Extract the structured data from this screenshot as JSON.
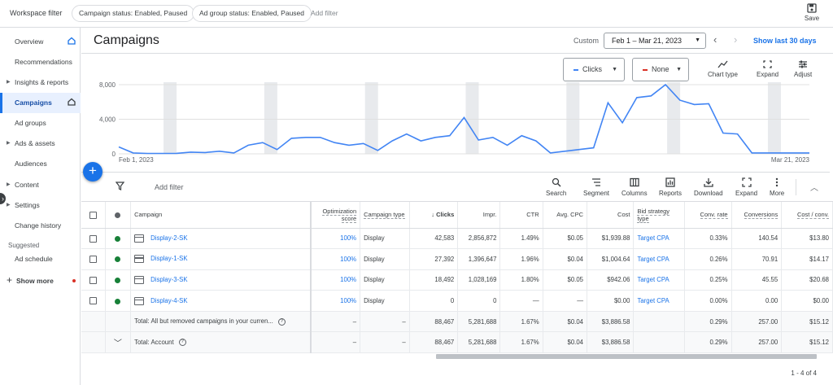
{
  "topbar": {
    "workspace_filter": "Workspace filter",
    "chips": [
      "Campaign status: Enabled, Paused",
      "Ad group status: Enabled, Paused"
    ],
    "add_filter": "Add filter",
    "save": "Save"
  },
  "sidebar": {
    "items": [
      {
        "label": "Overview",
        "arrow": false,
        "home": true
      },
      {
        "label": "Recommendations",
        "arrow": false
      },
      {
        "label": "Insights & reports",
        "arrow": true
      },
      {
        "label": "Campaigns",
        "arrow": false,
        "home": true,
        "active": true
      },
      {
        "label": "Ad groups",
        "arrow": false
      },
      {
        "label": "Ads & assets",
        "arrow": true
      },
      {
        "label": "Audiences",
        "arrow": false
      },
      {
        "label": "Content",
        "arrow": true
      },
      {
        "label": "Settings",
        "arrow": true
      },
      {
        "label": "Change history",
        "arrow": false
      }
    ],
    "suggested": "Suggested",
    "suggested_items": [
      {
        "label": "Ad schedule"
      }
    ],
    "show_more": "Show more"
  },
  "header": {
    "title": "Campaigns",
    "range_type": "Custom",
    "date_range": "Feb 1 – Mar 21, 2023",
    "last_30": "Show last 30 days"
  },
  "chart_controls": {
    "metric1": "Clicks",
    "metric2": "None",
    "chart_type": "Chart type",
    "expand": "Expand",
    "adjust": "Adjust"
  },
  "chart_data": {
    "type": "line",
    "ylim": [
      0,
      8000
    ],
    "y_ticks": [
      "8,000",
      "4,000",
      "0"
    ],
    "x_start_label": "Feb 1, 2023",
    "x_end_label": "Mar 21, 2023",
    "series": [
      {
        "name": "Clicks",
        "color": "#4285f4",
        "values": [
          800,
          100,
          50,
          50,
          60,
          200,
          150,
          300,
          100,
          1000,
          1300,
          500,
          1800,
          1900,
          1900,
          1300,
          1000,
          1200,
          400,
          1500,
          2300,
          1500,
          1900,
          2100,
          4200,
          1600,
          1900,
          1000,
          2100,
          1500,
          100,
          300,
          500,
          700,
          5900,
          3600,
          6500,
          6700,
          8000,
          6200,
          5700,
          5800,
          2400,
          2300,
          100,
          100,
          100,
          100,
          100
        ]
      }
    ],
    "weekend_bands": 7
  },
  "toolbar": {
    "add_filter": "Add filter",
    "buttons": [
      "Search",
      "Segment",
      "Columns",
      "Reports",
      "Download",
      "Expand",
      "More"
    ]
  },
  "table": {
    "headers": [
      "Campaign",
      "Optimization score",
      "Campaign type",
      "Clicks",
      "Impr.",
      "CTR",
      "Avg. CPC",
      "Cost",
      "Bid strategy type",
      "Conv. rate",
      "Conversions",
      "Cost / conv."
    ],
    "rows": [
      {
        "name": "Display-2-SK",
        "opt": "100%",
        "type": "Display",
        "clicks": "42,583",
        "impr": "2,856,872",
        "ctr": "1.49%",
        "cpc": "$0.05",
        "cost": "$1,939.88",
        "bid": "Target CPA",
        "convrate": "0.33%",
        "conv": "140.54",
        "cpconv": "$13.80"
      },
      {
        "name": "Display-1-SK",
        "opt": "100%",
        "type": "Display",
        "clicks": "27,392",
        "impr": "1,396,647",
        "ctr": "1.96%",
        "cpc": "$0.04",
        "cost": "$1,004.64",
        "bid": "Target CPA",
        "convrate": "0.26%",
        "conv": "70.91",
        "cpconv": "$14.17"
      },
      {
        "name": "Display-3-SK",
        "opt": "100%",
        "type": "Display",
        "clicks": "18,492",
        "impr": "1,028,169",
        "ctr": "1.80%",
        "cpc": "$0.05",
        "cost": "$942.06",
        "bid": "Target CPA",
        "convrate": "0.25%",
        "conv": "45.55",
        "cpconv": "$20.68"
      },
      {
        "name": "Display-4-SK",
        "opt": "100%",
        "type": "Display",
        "clicks": "0",
        "impr": "0",
        "ctr": "—",
        "cpc": "—",
        "cost": "$0.00",
        "bid": "Target CPA",
        "convrate": "0.00%",
        "conv": "0.00",
        "cpconv": "$0.00"
      }
    ],
    "totals": [
      {
        "name": "Total: All but removed campaigns in your curren...",
        "opt": "–",
        "type": "–",
        "clicks": "88,467",
        "impr": "5,281,688",
        "ctr": "1.67%",
        "cpc": "$0.04",
        "cost": "$3,886.58",
        "bid": "",
        "convrate": "0.29%",
        "conv": "257.00",
        "cpconv": "$15.12"
      },
      {
        "name": "Total: Account",
        "opt": "–",
        "type": "–",
        "clicks": "88,467",
        "impr": "5,281,688",
        "ctr": "1.67%",
        "cpc": "$0.04",
        "cost": "$3,886.58",
        "bid": "",
        "convrate": "0.29%",
        "conv": "257.00",
        "cpconv": "$15.12"
      }
    ]
  },
  "pager": "1 - 4 of 4"
}
